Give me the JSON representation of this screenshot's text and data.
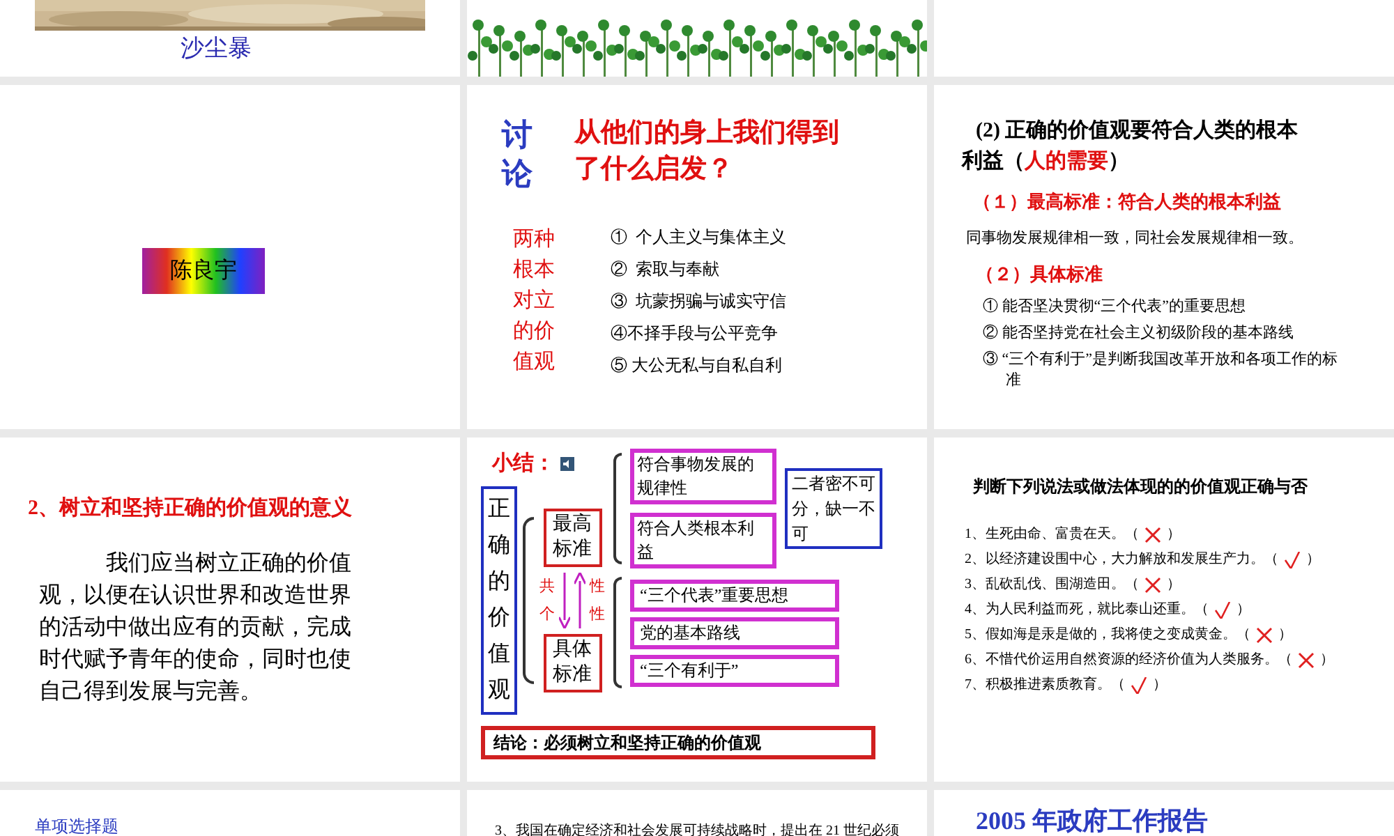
{
  "slides": [
    {
      "kind": "photo_caption",
      "caption": "沙尘暴"
    },
    {
      "kind": "photo_plants"
    },
    {
      "kind": "blank"
    },
    {
      "kind": "name_tag",
      "name": "陈良宇"
    },
    {
      "kind": "discussion",
      "label_chars": [
        "讨",
        "论"
      ],
      "title": "从他们的身上我们得到了什么启发？",
      "side_lines": [
        "两种",
        "根本",
        "对立",
        "的价",
        "值观"
      ],
      "items": [
        "①  个人主义与集体主义",
        "②  索取与奉献",
        "③  坑蒙拐骗与诚实守信",
        "④不择手段与公平竞争",
        "⑤ 大公无私与自私自利"
      ]
    },
    {
      "kind": "standards",
      "title_before": "(2) 正确的价值观要符合人类的根本利益（",
      "title_highlight": "人的需要",
      "title_after": "）",
      "heading_1": "（１）最高标准：符合人类的根本利益",
      "line_1": "同事物发展规律相一致，同社会发展规律相一致。",
      "heading_2": "（２）具体标准",
      "items": [
        "① 能否坚决贯彻“三个代表”的重要思想",
        "② 能否坚持党在社会主义初级阶段的基本路线",
        "③ “三个有利于”是判断我国改革开放和各项工作的标准"
      ]
    },
    {
      "kind": "meaning",
      "title": "2、树立和坚持正确的价值观的意义",
      "paragraph": "我们应当树立正确的价值观，以便在认识世界和改造世界的活动中做出应有的贡献，完成时代赋予青年的使命，同时也使自己得到发展与完善。"
    },
    {
      "kind": "summary",
      "title": "小结：",
      "main": "正确的价值观",
      "top_box": "最高标准",
      "bottom_box": "具体标准",
      "left_labels": [
        "共",
        "个"
      ],
      "right_labels": [
        "性",
        "性"
      ],
      "top_items": [
        "符合事物发展的规律性",
        "符合人类根本利益"
      ],
      "bottom_items": [
        "“三个代表”重要思想",
        "党的基本路线",
        "“三个有利于”"
      ],
      "note": "二者密不可分，缺一不可",
      "conclusion": "结论：必须树立和坚持正确的价值观"
    },
    {
      "kind": "judge",
      "title": "判断下列说法或做法体现的的价值观正确与否",
      "items": [
        {
          "text": "1、生死由命、富贵在天。（",
          "correct": false,
          "close": "）"
        },
        {
          "text": "2、以经济建设围中心，大力解放和发展生产力。（",
          "correct": true,
          "close": "）"
        },
        {
          "text": "3、乱砍乱伐、围湖造田。（",
          "correct": false,
          "close": "）"
        },
        {
          "text": "4、为人民利益而死，就比泰山还重。（",
          "correct": true,
          "close": "）"
        },
        {
          "text": "5、假如海是汞是做的，我将使之变成黄金。（",
          "correct": false,
          "close": "）"
        },
        {
          "text": "6、不惜代价运用自然资源的经济价值为人类服务。（",
          "correct": false,
          "close": "）"
        },
        {
          "text": "7、积极推进素质教育。（",
          "correct": true,
          "close": "）"
        }
      ]
    },
    {
      "kind": "heading_only",
      "heading": "单项选择题"
    },
    {
      "kind": "question_start",
      "text": "3、我国在确定经济和社会发展可持续战略时，提出在 21 世纪必须"
    },
    {
      "kind": "big_title",
      "title": "2005 年政府工作报告"
    }
  ]
}
